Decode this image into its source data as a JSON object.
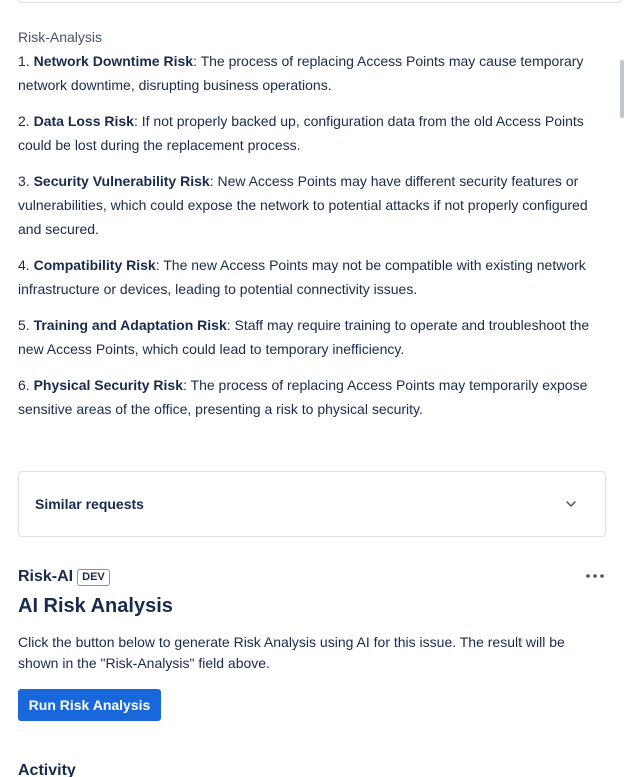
{
  "field": {
    "label": "Risk-Analysis"
  },
  "risks": [
    {
      "number": "1.",
      "title": "Network Downtime Risk",
      "text": ": The process of replacing Access Points may cause temporary network downtime, disrupting business operations."
    },
    {
      "number": "2.",
      "title": "Data Loss Risk",
      "text": ": If not properly backed up, configuration data from the old Access Points could be lost during the replacement process."
    },
    {
      "number": "3.",
      "title": "Security Vulnerability Risk",
      "text": ": New Access Points may have different security features or vulnerabilities, which could expose the network to potential attacks if not properly configured and secured."
    },
    {
      "number": "4.",
      "title": "Compatibility Risk",
      "text": ": The new Access Points may not be compatible with existing network infrastructure or devices, leading to potential connectivity issues."
    },
    {
      "number": "5.",
      "title": "Training and Adaptation Risk",
      "text": ": Staff may require training to operate and troubleshoot the new Access Points, which could lead to temporary inefficiency."
    },
    {
      "number": "6.",
      "title": "Physical Security Risk",
      "text": ": The process of replacing Access Points may temporarily expose sensitive areas of the office, presenting a risk to physical security."
    }
  ],
  "similar_requests": {
    "title": "Similar requests",
    "icon": "chevron-down-icon"
  },
  "app": {
    "name": "Risk-AI",
    "badge": "DEV",
    "more_icon": "more-icon",
    "title": "AI Risk Analysis",
    "description": "Click the button below to generate Risk Analysis using AI for this issue. The result will be shown in the \"Risk-Analysis\" field above.",
    "button_label": "Run Risk Analysis",
    "button_color": "#1868db"
  },
  "activity": {
    "title": "Activity"
  }
}
